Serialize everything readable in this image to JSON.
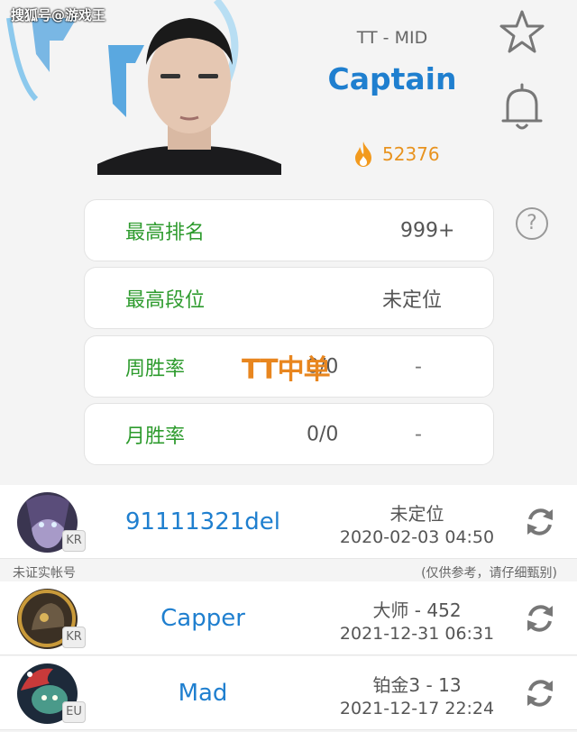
{
  "watermark": "搜狐号@游戏王",
  "player": {
    "team_role": "TT - MID",
    "name": "Captain",
    "heat": "52376"
  },
  "stats": [
    {
      "label": "最高排名",
      "value": "999+",
      "extra": ""
    },
    {
      "label": "最高段位",
      "value": "未定位",
      "extra": ""
    },
    {
      "label": "周胜率",
      "value": "0/0",
      "extra": "-"
    },
    {
      "label": "月胜率",
      "value": "0/0",
      "extra": "-"
    }
  ],
  "overlay": "TT中单",
  "help_icon": "?",
  "accounts": [
    {
      "name": "91111321del",
      "region": "KR",
      "rank": "未定位",
      "time": "2020-02-03 04:50"
    },
    {
      "name": "Capper",
      "region": "KR",
      "rank": "大师 - 452",
      "time": "2021-12-31 06:31"
    },
    {
      "name": "Mad",
      "region": "EU",
      "rank": "铂金3 - 13",
      "time": "2021-12-17 22:24"
    }
  ],
  "note": {
    "left": "未证实帐号",
    "right": "(仅供参考，请仔细甄别)"
  },
  "colors": {
    "accent": "#1f7fcf",
    "green": "#2e9b2e",
    "heat": "#e8931f"
  }
}
